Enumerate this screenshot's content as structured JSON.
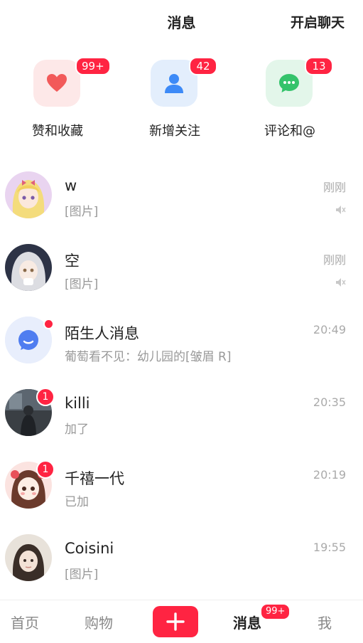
{
  "header": {
    "title": "消息",
    "action": "开启聊天"
  },
  "quick_actions": [
    {
      "label": "赞和收藏",
      "badge": "99+",
      "icon": "heart-icon",
      "color": "#f25a5a",
      "bg": "#fde8e8"
    },
    {
      "label": "新增关注",
      "badge": "42",
      "icon": "person-icon",
      "color": "#3d8af7",
      "bg": "#e3eefc"
    },
    {
      "label": "评论和@",
      "badge": "13",
      "icon": "chat-bubble-icon",
      "color": "#34c36b",
      "bg": "#e3f6ea"
    }
  ],
  "conversations": [
    {
      "name": "w",
      "preview": "[图片]",
      "time": "刚刚",
      "badge": "",
      "muted": true
    },
    {
      "name": "空",
      "preview": "[图片]",
      "time": "刚刚",
      "badge": "",
      "muted": true
    },
    {
      "name": "陌生人消息",
      "preview": "葡萄看不见：幼儿园的[皱眉 R]",
      "time": "20:49",
      "badge": "",
      "dot": true
    },
    {
      "name": "killi",
      "preview": "加了",
      "time": "20:35",
      "badge": "1"
    },
    {
      "name": "千禧一代",
      "preview": "已加",
      "time": "20:19",
      "badge": "1"
    },
    {
      "name": "Coisini",
      "preview": "[图片]",
      "time": "19:55",
      "badge": ""
    }
  ],
  "bottom_nav": {
    "home": "首页",
    "shop": "购物",
    "messages": "消息",
    "messages_badge": "99+",
    "me": "我"
  },
  "colors": {
    "accent": "#ff2442"
  }
}
